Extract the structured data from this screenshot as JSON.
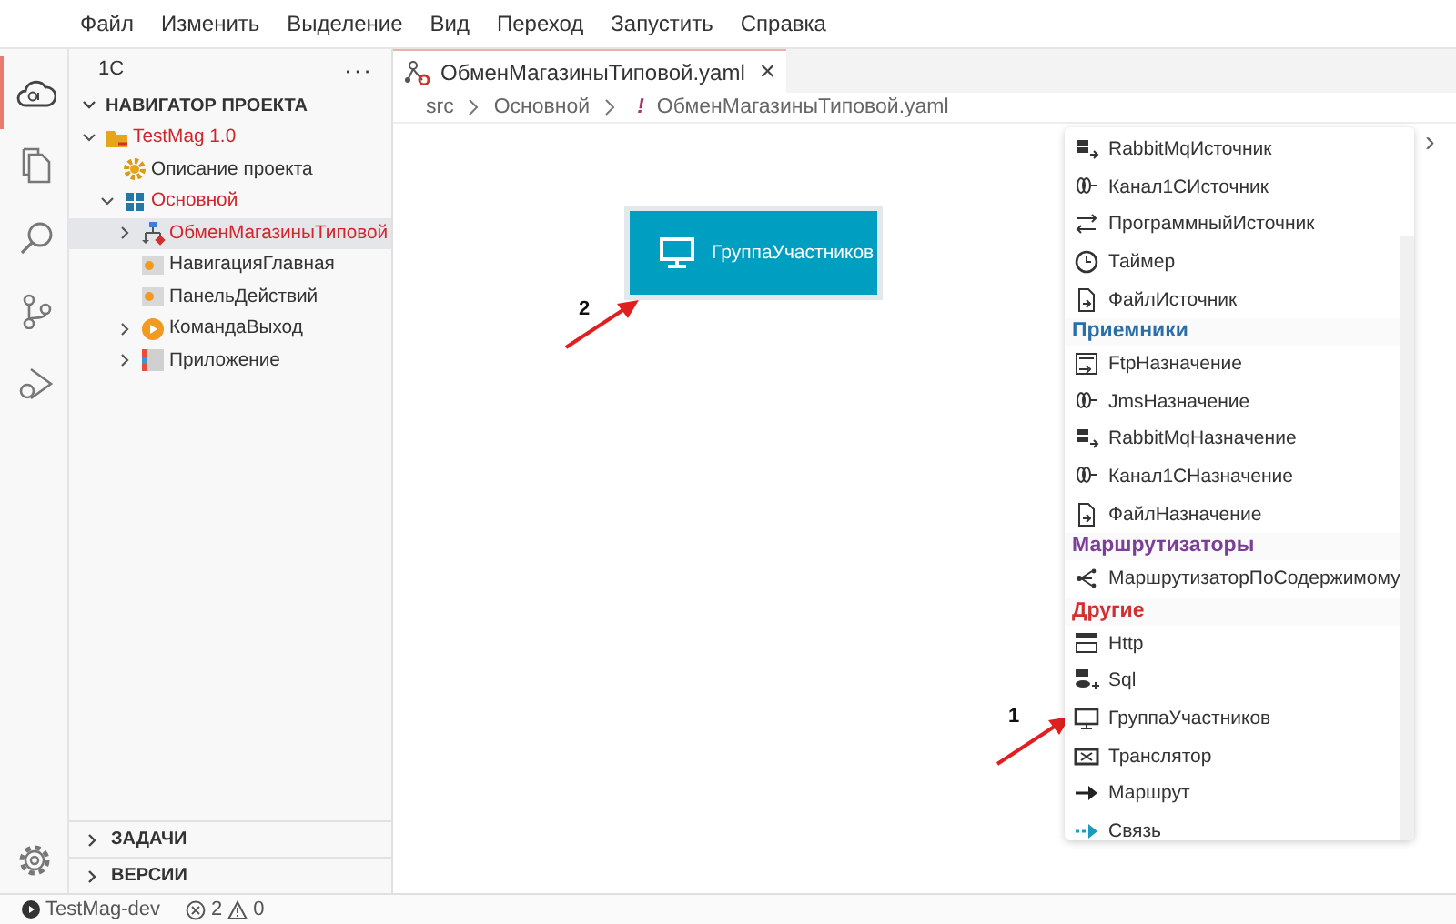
{
  "menu": [
    "Файл",
    "Изменить",
    "Выделение",
    "Вид",
    "Переход",
    "Запустить",
    "Справка"
  ],
  "activity_bar": [
    {
      "kind": "cloud",
      "selected": true
    },
    {
      "kind": "files",
      "selected": false
    },
    {
      "kind": "search",
      "selected": false
    },
    {
      "kind": "source-control",
      "selected": false
    },
    {
      "kind": "debug",
      "selected": false
    }
  ],
  "sidebar": {
    "title": "1С",
    "more": "···",
    "section": "НАВИГАТОР ПРОЕКТА",
    "tree": [
      {
        "label": "TestMag 1.0",
        "kind": "project",
        "expanded": true,
        "highlighted": true,
        "selected": false,
        "children": [
          {
            "label": "Описание проекта",
            "kind": "gear",
            "highlighted": false,
            "selected": false
          },
          {
            "label": "Основной",
            "kind": "grid",
            "expanded": true,
            "highlighted": true,
            "selected": false,
            "children": [
              {
                "label": "ОбменМагазиныТиповой",
                "kind": "flow",
                "expanded": false,
                "highlighted": true,
                "selected": true
              },
              {
                "label": "НавигацияГлавная",
                "kind": "panel",
                "highlighted": false,
                "selected": false
              },
              {
                "label": "ПанельДействий",
                "kind": "panel",
                "highlighted": false,
                "selected": false
              },
              {
                "label": "КомандаВыход",
                "kind": "command",
                "expanded": false,
                "highlighted": false,
                "selected": false
              },
              {
                "label": "Приложение",
                "kind": "app",
                "expanded": false,
                "highlighted": false,
                "selected": false
              }
            ]
          }
        ]
      }
    ],
    "bottom_sections": [
      "ЗАДАЧИ",
      "ВЕРСИИ"
    ]
  },
  "tab": {
    "title": "ОбменМагазиныТиповой.yaml",
    "close": "×"
  },
  "breadcrumbs": [
    "src",
    "Основной",
    "ОбменМагазиныТиповой.yaml"
  ],
  "breadcrumb_mark": "!",
  "canvas": {
    "node": {
      "label": "ГруппаУчастников"
    },
    "annotations": [
      {
        "number": "2"
      },
      {
        "number": "1"
      }
    ]
  },
  "palette": {
    "groups": [
      {
        "items": [
          {
            "label": "RabbitMqИсточник",
            "kind": "stack"
          },
          {
            "label": "Канал1СИсточник",
            "kind": "coil"
          },
          {
            "label": "ПрограммныйИсточник",
            "kind": "double-arrow"
          },
          {
            "label": "Таймер",
            "kind": "clock"
          },
          {
            "label": "ФайлИсточник",
            "kind": "file"
          }
        ]
      },
      {
        "heading": "Приемники",
        "color": "#2a6fa8",
        "items": [
          {
            "label": "FtpНазначение",
            "kind": "folder"
          },
          {
            "label": "JmsНазначение",
            "kind": "coil"
          },
          {
            "label": "RabbitMqНазначение",
            "kind": "stack"
          },
          {
            "label": "Канал1СНазначение",
            "kind": "coil"
          },
          {
            "label": "ФайлНазначение",
            "kind": "file"
          }
        ]
      },
      {
        "heading": "Маршрутизаторы",
        "color": "#7b3f98",
        "items": [
          {
            "label": "МаршрутизаторПоСодержимому",
            "kind": "branch"
          }
        ]
      },
      {
        "heading": "Другие",
        "color": "#d03030",
        "items": [
          {
            "label": "Http",
            "kind": "bars"
          },
          {
            "label": "Sql",
            "kind": "database"
          },
          {
            "label": "ГруппаУчастников",
            "kind": "monitor"
          },
          {
            "label": "Транслятор",
            "kind": "cross-box"
          },
          {
            "label": "Маршрут",
            "kind": "arrow"
          },
          {
            "label": "Связь",
            "kind": "dashed-arrow"
          }
        ]
      }
    ],
    "expand": "›"
  },
  "status": {
    "run": "TestMag-dev",
    "errors": "2",
    "warnings": "0"
  }
}
